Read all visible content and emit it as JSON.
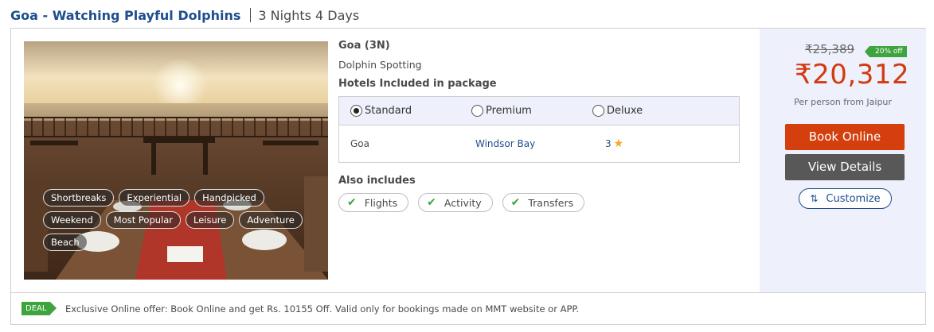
{
  "header": {
    "title": "Goa - Watching Playful Dolphins",
    "duration": "3 Nights 4 Days"
  },
  "package": {
    "tags": [
      "Shortbreaks",
      "Experiential",
      "Handpicked",
      "Weekend",
      "Most Popular",
      "Leisure",
      "Adventure",
      "Beach"
    ],
    "destination": "Goa (3N)",
    "activity": "Dolphin Spotting",
    "hotels_heading": "Hotels Included in package",
    "hotel_tabs": [
      {
        "label": "Standard",
        "selected": true
      },
      {
        "label": "Premium",
        "selected": false
      },
      {
        "label": "Deluxe",
        "selected": false
      }
    ],
    "hotel": {
      "city": "Goa",
      "name": "Windsor Bay",
      "rating": "3"
    },
    "also_heading": "Also includes",
    "includes": [
      "Flights",
      "Activity",
      "Transfers"
    ]
  },
  "pricing": {
    "original_price": "₹25,389",
    "discount_badge": "20% off",
    "price": "₹20,312",
    "per_person": "Per person from Jaipur",
    "book_label": "Book Online",
    "view_label": "View Details",
    "customize_label": "Customize"
  },
  "deal": {
    "tag": "DEAL",
    "text": "Exclusive Online offer: Book Online and get Rs. 10155 Off. Valid only for bookings made on MMT website or APP."
  },
  "colors": {
    "title_blue": "#1f4e8c",
    "price_red": "#d23a12",
    "book_button": "#d43f0d",
    "view_button": "#585858",
    "deal_green": "#3ea43e",
    "panel_bg": "#eef0fb"
  },
  "icons": {
    "check": "check-icon",
    "star": "star-icon",
    "customize": "sliders-icon"
  }
}
